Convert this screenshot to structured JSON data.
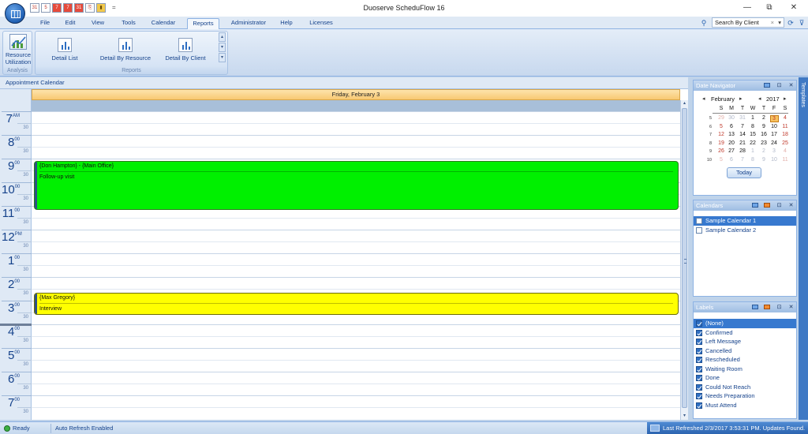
{
  "window": {
    "title": "Duoserve ScheduFlow 16",
    "controls": [
      "—",
      "⧉",
      "✕"
    ]
  },
  "qat": {
    "buttons": [
      "31",
      "5",
      "7",
      "7",
      "31",
      "⎘",
      "▮"
    ],
    "dropdown": "="
  },
  "ribbon_tabs": [
    {
      "label": "File"
    },
    {
      "label": "Edit"
    },
    {
      "label": "View"
    },
    {
      "label": "Tools"
    },
    {
      "label": "Calendar"
    },
    {
      "label": "Reports",
      "active": true
    },
    {
      "label": "Administrator"
    },
    {
      "label": "Help"
    },
    {
      "label": "Licenses"
    }
  ],
  "search": {
    "value": "Search By Client",
    "clear": "×",
    "arrow": "▾"
  },
  "ribbon": {
    "analysis_group": {
      "label": "Analysis",
      "button_line1": "Resource",
      "button_line2": "Utilization"
    },
    "reports_group": {
      "label": "Reports",
      "buttons": [
        "Detail List",
        "Detail By Resource",
        "Detail By Client"
      ]
    }
  },
  "calendar": {
    "pane_title": "Appointment Calendar",
    "day_header": "Friday, February 3",
    "hours": [
      {
        "hour": "7",
        "suffix": "AM"
      },
      {
        "hour": "8",
        "suffix": "00"
      },
      {
        "hour": "9",
        "suffix": "00"
      },
      {
        "hour": "10",
        "suffix": "00"
      },
      {
        "hour": "11",
        "suffix": "00"
      },
      {
        "hour": "12",
        "suffix": "PM"
      },
      {
        "hour": "1",
        "suffix": "00"
      },
      {
        "hour": "2",
        "suffix": "00"
      },
      {
        "hour": "3",
        "suffix": "00"
      },
      {
        "hour": "4",
        "suffix": "00"
      },
      {
        "hour": "5",
        "suffix": "00"
      },
      {
        "hour": "6",
        "suffix": "00"
      },
      {
        "hour": "7",
        "suffix": "00"
      }
    ],
    "half_label": "30",
    "appointments": [
      {
        "title": "{Don Hampton} - {Main Office}",
        "body": "Follow-up visit",
        "color": "#00f000",
        "border": "#2c7a1e"
      },
      {
        "title": "{Max Gregory}",
        "body": "Interview",
        "color": "#ffff00",
        "border": "#6d6d00"
      }
    ]
  },
  "date_navigator": {
    "title": "Date Navigator",
    "month": "February",
    "year": "2017",
    "prev": "◂",
    "next": "▸",
    "days_of_week": [
      "S",
      "M",
      "T",
      "W",
      "T",
      "F",
      "S"
    ],
    "weeks": [
      {
        "wk": "5",
        "days": [
          "29",
          "30",
          "31",
          "1",
          "2",
          "3",
          "4"
        ]
      },
      {
        "wk": "6",
        "days": [
          "5",
          "6",
          "7",
          "8",
          "9",
          "10",
          "11"
        ]
      },
      {
        "wk": "7",
        "days": [
          "12",
          "13",
          "14",
          "15",
          "16",
          "17",
          "18"
        ]
      },
      {
        "wk": "8",
        "days": [
          "19",
          "20",
          "21",
          "22",
          "23",
          "24",
          "25"
        ]
      },
      {
        "wk": "9",
        "days": [
          "26",
          "27",
          "28",
          "1",
          "2",
          "3",
          "4"
        ]
      },
      {
        "wk": "10",
        "days": [
          "5",
          "6",
          "7",
          "8",
          "9",
          "10",
          "11"
        ]
      }
    ],
    "today_label": "Today"
  },
  "calendars_panel": {
    "title": "Calendars",
    "items": [
      {
        "label": "Sample Calendar 1",
        "selected": true
      },
      {
        "label": "Sample Calendar 2",
        "selected": false
      }
    ]
  },
  "labels_panel": {
    "title": "Labels",
    "items": [
      "(None)",
      "Confirmed",
      "Left Message",
      "Cancelled",
      "Rescheduled",
      "Waiting Room",
      "Done",
      "Could Not Reach",
      "Needs Preparation",
      "Must Attend"
    ]
  },
  "dock_tab": "Templates",
  "status": {
    "ready": "Ready",
    "auto_refresh": "Auto Refresh Enabled",
    "last_refreshed": "Last Refreshed 2/3/2017 3:53:31 PM. Updates Found."
  }
}
